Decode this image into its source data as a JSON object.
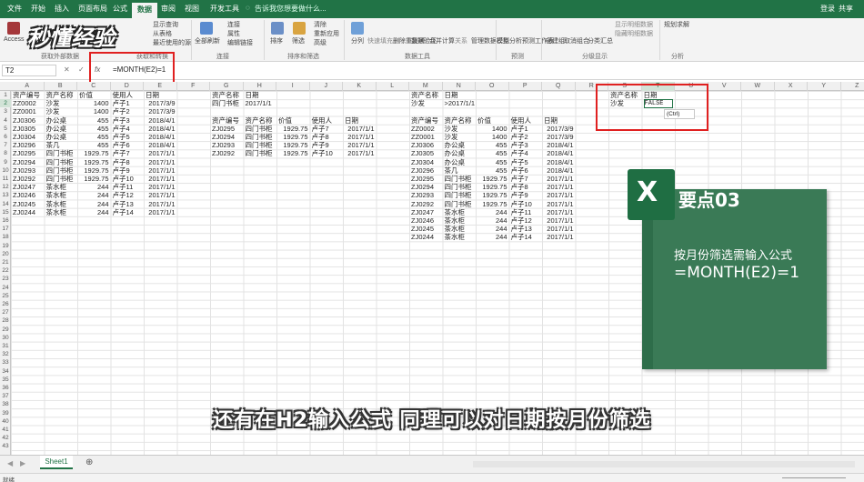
{
  "ribbon_tabs": [
    "文件",
    "开始",
    "插入",
    "页面布局",
    "公式",
    "数据",
    "审阅",
    "视图",
    "开发工具"
  ],
  "active_tab": "数据",
  "tell_me": "告诉我您想要做什么...",
  "user": {
    "login": "登录",
    "share": "共享"
  },
  "ribbon": {
    "access": "Access",
    "show_query": "显示查询",
    "from_table": "从表格",
    "recent_sources": "最近使用的源",
    "refresh_all": "全部刷新",
    "connections": "连接",
    "properties": "属性",
    "edit_links": "编辑链接",
    "sort": "排序",
    "filter": "筛选",
    "clear": "清除",
    "reapply": "重新应用",
    "advanced": "高级",
    "text_to_columns": "分列",
    "flash_fill": "快速填充",
    "remove_dup": "删除重复项",
    "validation": "数据验证",
    "consolidate": "合并计算",
    "relationships": "关系",
    "data_model": "管理数据模型",
    "whatif": "模拟分析",
    "forecast": "预测工作表",
    "group": "创建组",
    "ungroup": "取消组合",
    "subtotal": "分类汇总",
    "show_detail": "显示明细数据",
    "hide_detail": "隐藏明细数据",
    "solver": "规划求解",
    "groups": [
      "获取外部数据",
      "获取和转换",
      "连接",
      "排序和筛选",
      "数据工具",
      "预测",
      "分级显示",
      "分析"
    ]
  },
  "formula_bar": {
    "name_box": "T2",
    "fx": "fx",
    "formula": "=MONTH(E2)=1"
  },
  "columns": [
    "A",
    "B",
    "C",
    "D",
    "E",
    "F",
    "G",
    "H",
    "I",
    "J",
    "K",
    "L",
    "M",
    "N",
    "O",
    "P",
    "Q",
    "R",
    "S",
    "T",
    "U",
    "V",
    "W",
    "X",
    "Y",
    "Z"
  ],
  "rows": [
    "1",
    "2",
    "3",
    "4",
    "5",
    "6",
    "7",
    "8",
    "9",
    "10",
    "11",
    "12",
    "13",
    "14",
    "15",
    "16",
    "17",
    "18",
    "19",
    "20",
    "21",
    "22",
    "23",
    "24",
    "25",
    "26",
    "27",
    "28",
    "29",
    "30",
    "31",
    "32",
    "33",
    "34",
    "35",
    "36",
    "37",
    "38",
    "39",
    "40",
    "41",
    "42",
    "43"
  ],
  "table1": {
    "headers": [
      "资产编号",
      "资产名称",
      "价值",
      "使用人",
      "日期"
    ],
    "rows": [
      [
        "ZZ0002",
        "沙发",
        "1400",
        "卢子1",
        "2017/3/9"
      ],
      [
        "ZZ0001",
        "沙发",
        "1400",
        "卢子2",
        "2017/3/9"
      ],
      [
        "ZJ0306",
        "办公桌",
        "455",
        "卢子3",
        "2018/4/1"
      ],
      [
        "ZJ0305",
        "办公桌",
        "455",
        "卢子4",
        "2018/4/1"
      ],
      [
        "ZJ0304",
        "办公桌",
        "455",
        "卢子5",
        "2018/4/1"
      ],
      [
        "ZJ0296",
        "茶几",
        "455",
        "卢子6",
        "2018/4/1"
      ],
      [
        "ZJ0295",
        "四门书柜",
        "1929.75",
        "卢子7",
        "2017/1/1"
      ],
      [
        "ZJ0294",
        "四门书柜",
        "1929.75",
        "卢子8",
        "2017/1/1"
      ],
      [
        "ZJ0293",
        "四门书柜",
        "1929.75",
        "卢子9",
        "2017/1/1"
      ],
      [
        "ZJ0292",
        "四门书柜",
        "1929.75",
        "卢子10",
        "2017/1/1"
      ],
      [
        "ZJ0247",
        "茶水柜",
        "244",
        "卢子11",
        "2017/1/1"
      ],
      [
        "ZJ0246",
        "茶水柜",
        "244",
        "卢子12",
        "2017/1/1"
      ],
      [
        "ZJ0245",
        "茶水柜",
        "244",
        "卢子13",
        "2017/1/1"
      ],
      [
        "ZJ0244",
        "茶水柜",
        "244",
        "卢子14",
        "2017/1/1"
      ]
    ]
  },
  "criteria1": {
    "headers": [
      "资产名称",
      "日期"
    ],
    "values": [
      "四门书柜",
      "2017/1/1"
    ]
  },
  "table2": {
    "headers": [
      "资产编号",
      "资产名称",
      "价值",
      "使用人",
      "日期"
    ],
    "rows": [
      [
        "ZJ0295",
        "四门书柜",
        "1929.75",
        "卢子7",
        "2017/1/1"
      ],
      [
        "ZJ0294",
        "四门书柜",
        "1929.75",
        "卢子8",
        "2017/1/1"
      ],
      [
        "ZJ0293",
        "四门书柜",
        "1929.75",
        "卢子9",
        "2017/1/1"
      ],
      [
        "ZJ0292",
        "四门书柜",
        "1929.75",
        "卢子10",
        "2017/1/1"
      ]
    ]
  },
  "criteria2": {
    "headers": [
      "资产名称",
      "日期"
    ],
    "values": [
      "沙发",
      ">2017/1/1"
    ]
  },
  "table3": {
    "headers": [
      "资产编号",
      "资产名称",
      "价值",
      "使用人",
      "日期"
    ],
    "rows": [
      [
        "ZZ0002",
        "沙发",
        "1400",
        "卢子1",
        "2017/3/9"
      ],
      [
        "ZZ0001",
        "沙发",
        "1400",
        "卢子2",
        "2017/3/9"
      ],
      [
        "ZJ0306",
        "办公桌",
        "455",
        "卢子3",
        "2018/4/1"
      ],
      [
        "ZJ0305",
        "办公桌",
        "455",
        "卢子4",
        "2018/4/1"
      ],
      [
        "ZJ0304",
        "办公桌",
        "455",
        "卢子5",
        "2018/4/1"
      ],
      [
        "ZJ0296",
        "茶几",
        "455",
        "卢子6",
        "2018/4/1"
      ],
      [
        "ZJ0295",
        "四门书柜",
        "1929.75",
        "卢子7",
        "2017/1/1"
      ],
      [
        "ZJ0294",
        "四门书柜",
        "1929.75",
        "卢子8",
        "2017/1/1"
      ],
      [
        "ZJ0293",
        "四门书柜",
        "1929.75",
        "卢子9",
        "2017/1/1"
      ],
      [
        "ZJ0292",
        "四门书柜",
        "1929.75",
        "卢子10",
        "2017/1/1"
      ],
      [
        "ZJ0247",
        "茶水柜",
        "244",
        "卢子11",
        "2017/1/1"
      ],
      [
        "ZJ0246",
        "茶水柜",
        "244",
        "卢子12",
        "2017/1/1"
      ],
      [
        "ZJ0245",
        "茶水柜",
        "244",
        "卢子13",
        "2017/1/1"
      ],
      [
        "ZJ0244",
        "茶水柜",
        "244",
        "卢子14",
        "2017/1/1"
      ]
    ]
  },
  "criteria3": {
    "headers": [
      "资产名称",
      "日期"
    ],
    "values": [
      "沙发",
      "FALSE"
    ]
  },
  "paste_options": "(Ctrl)",
  "sheet_tab": "Sheet1",
  "status": "就绪",
  "card": {
    "title": "要点03",
    "line1": "按月份筛选需输入公式",
    "line2": "=MONTH(E2)=1"
  },
  "caption": "还有在H2输入公式 同理可以对日期按月份筛选",
  "watermark": "秒懂经验",
  "colors": {
    "excel_green": "#217346",
    "card_green": "#2e6d4a",
    "highlight_red": "#e02020"
  }
}
